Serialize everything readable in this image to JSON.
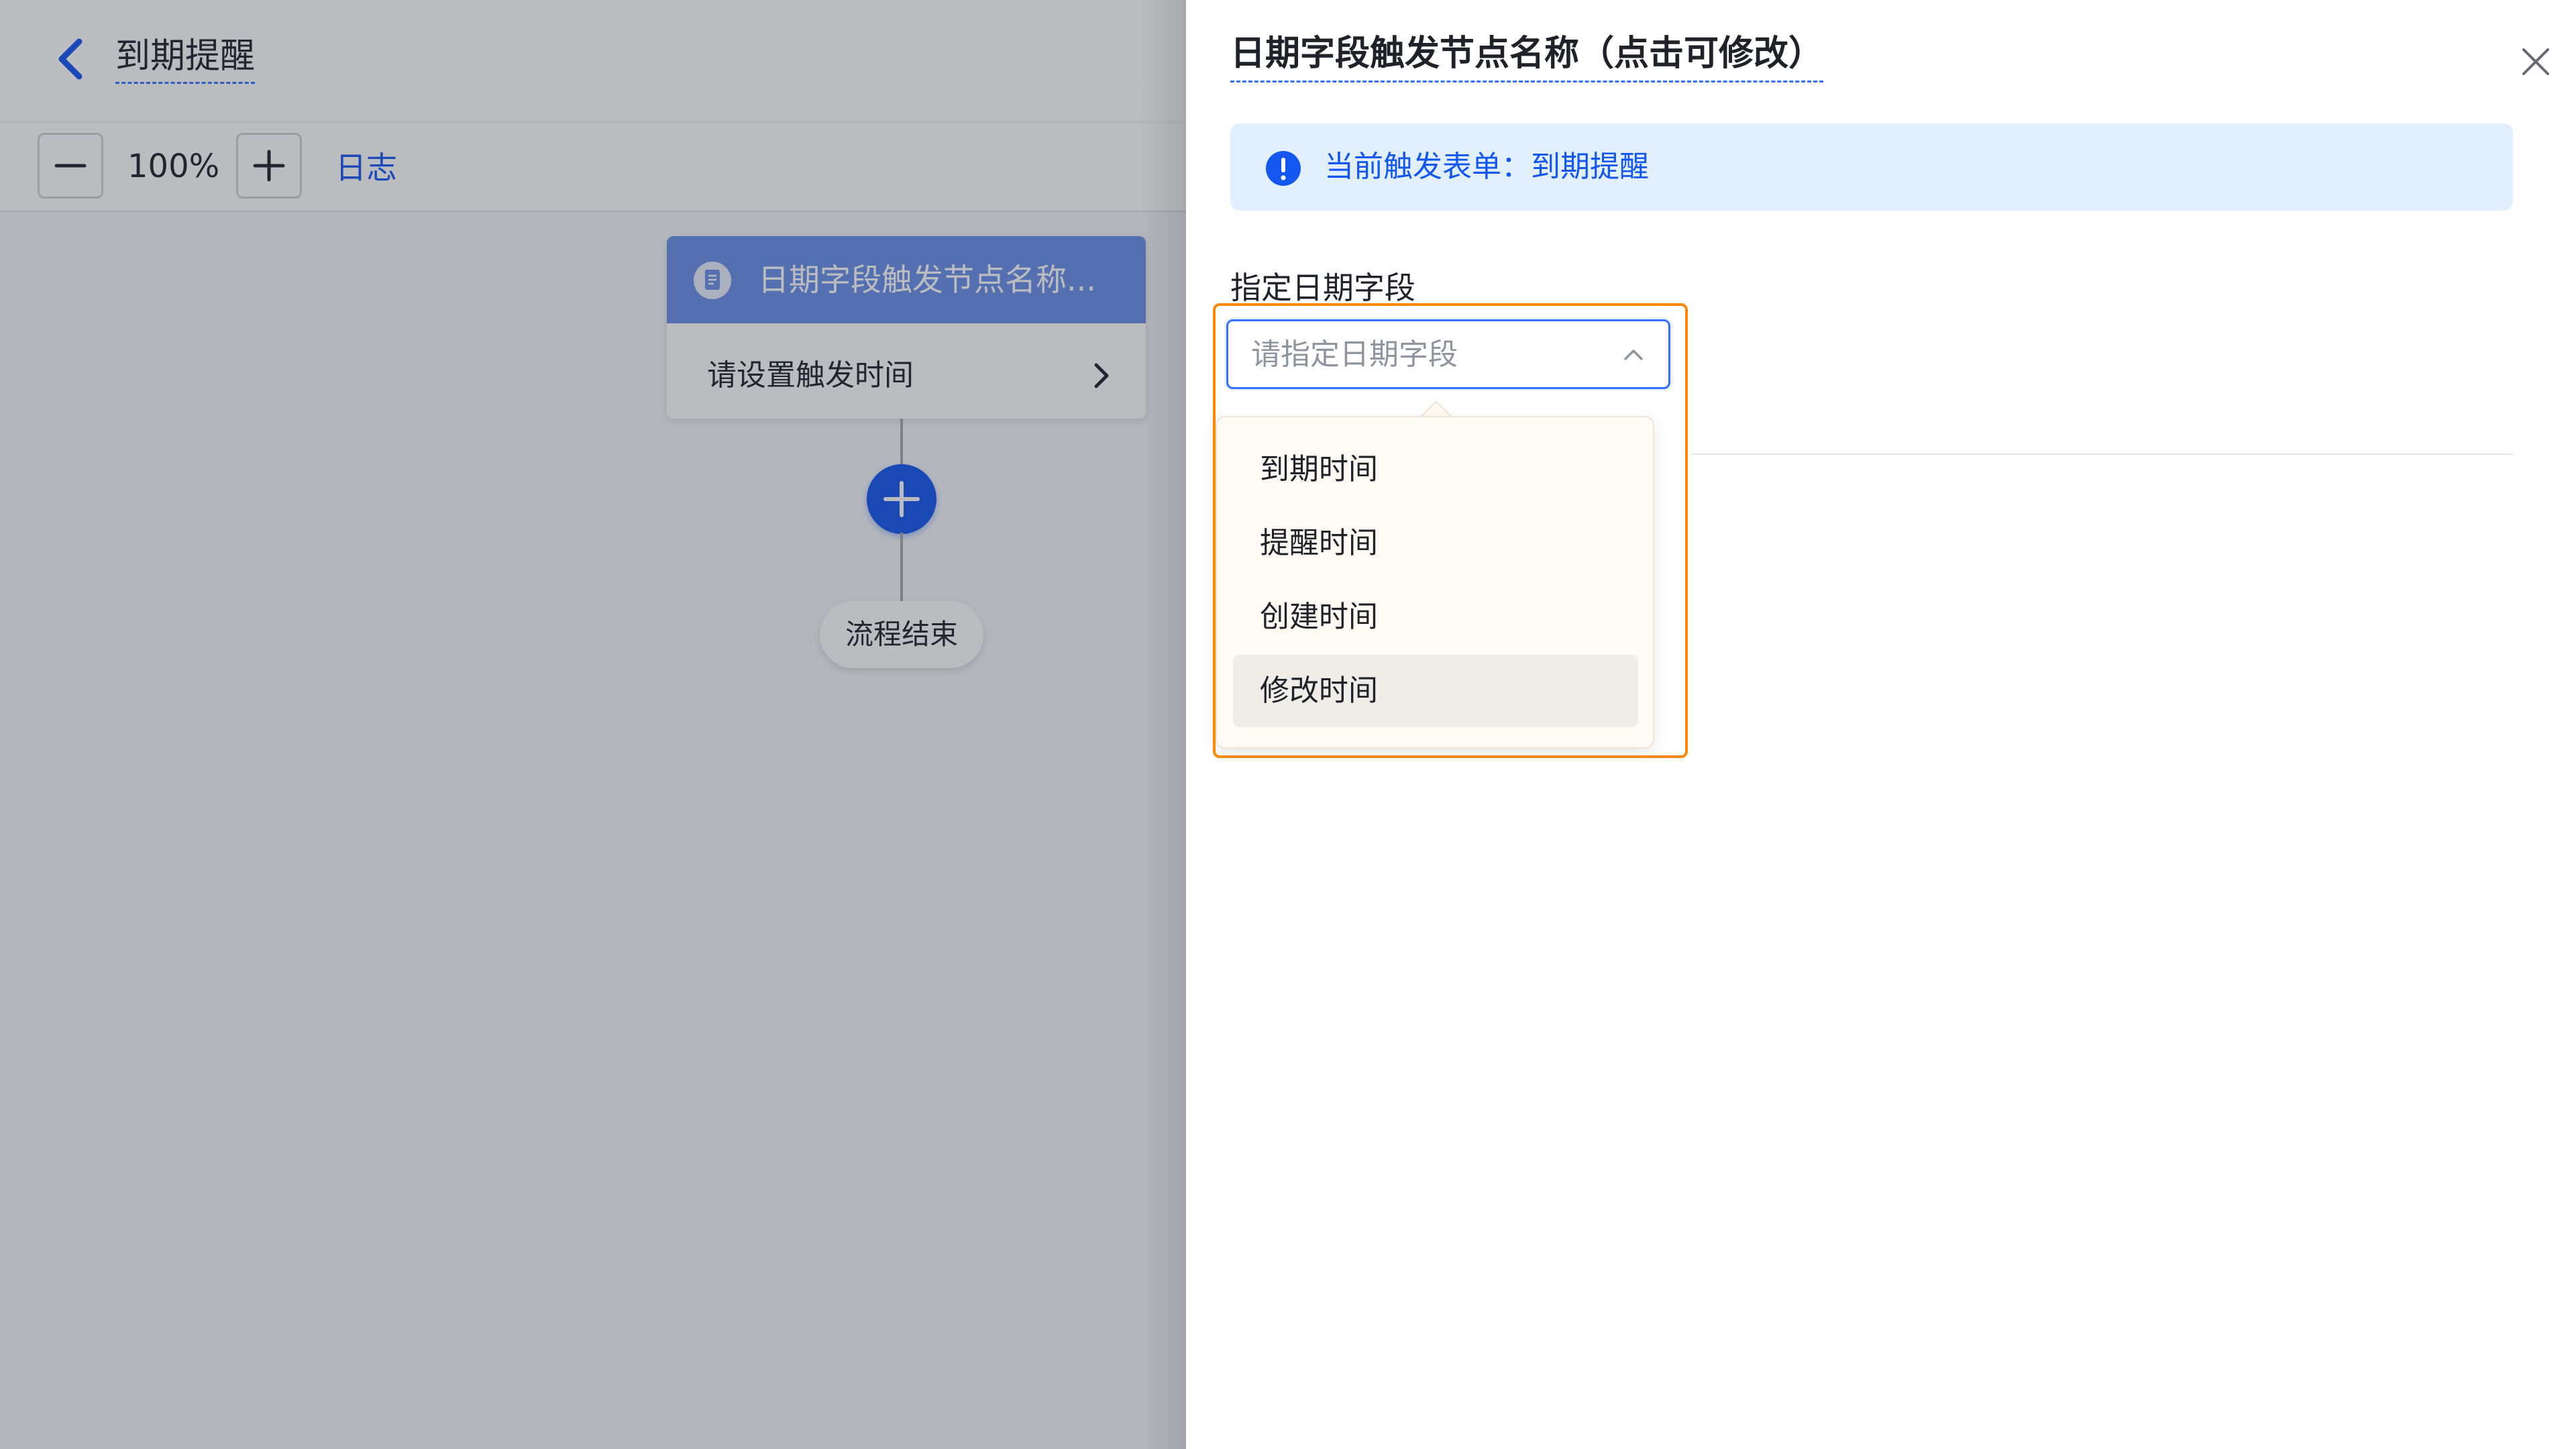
{
  "header": {
    "app_title": "到期提醒"
  },
  "toolbar": {
    "zoom_level": "100%",
    "log_label": "日志"
  },
  "flow": {
    "trigger_title": "日期字段触发节点名称...",
    "trigger_action": "请设置触发时间",
    "end_label": "流程结束"
  },
  "drawer": {
    "node_title": "日期字段触发节点名称（点击可修改）",
    "notice_text": "当前触发表单：到期提醒",
    "field_label": "指定日期字段",
    "select_placeholder": "请指定日期字段",
    "options": [
      {
        "label": "到期时间"
      },
      {
        "label": "提醒时间"
      },
      {
        "label": "创建时间"
      },
      {
        "label": "修改时间"
      }
    ]
  },
  "colors": {
    "primary": "#1456f0",
    "trigger_header": "#6b8fe8",
    "notice_bg": "#e1efff",
    "highlight": "#ff8800"
  }
}
